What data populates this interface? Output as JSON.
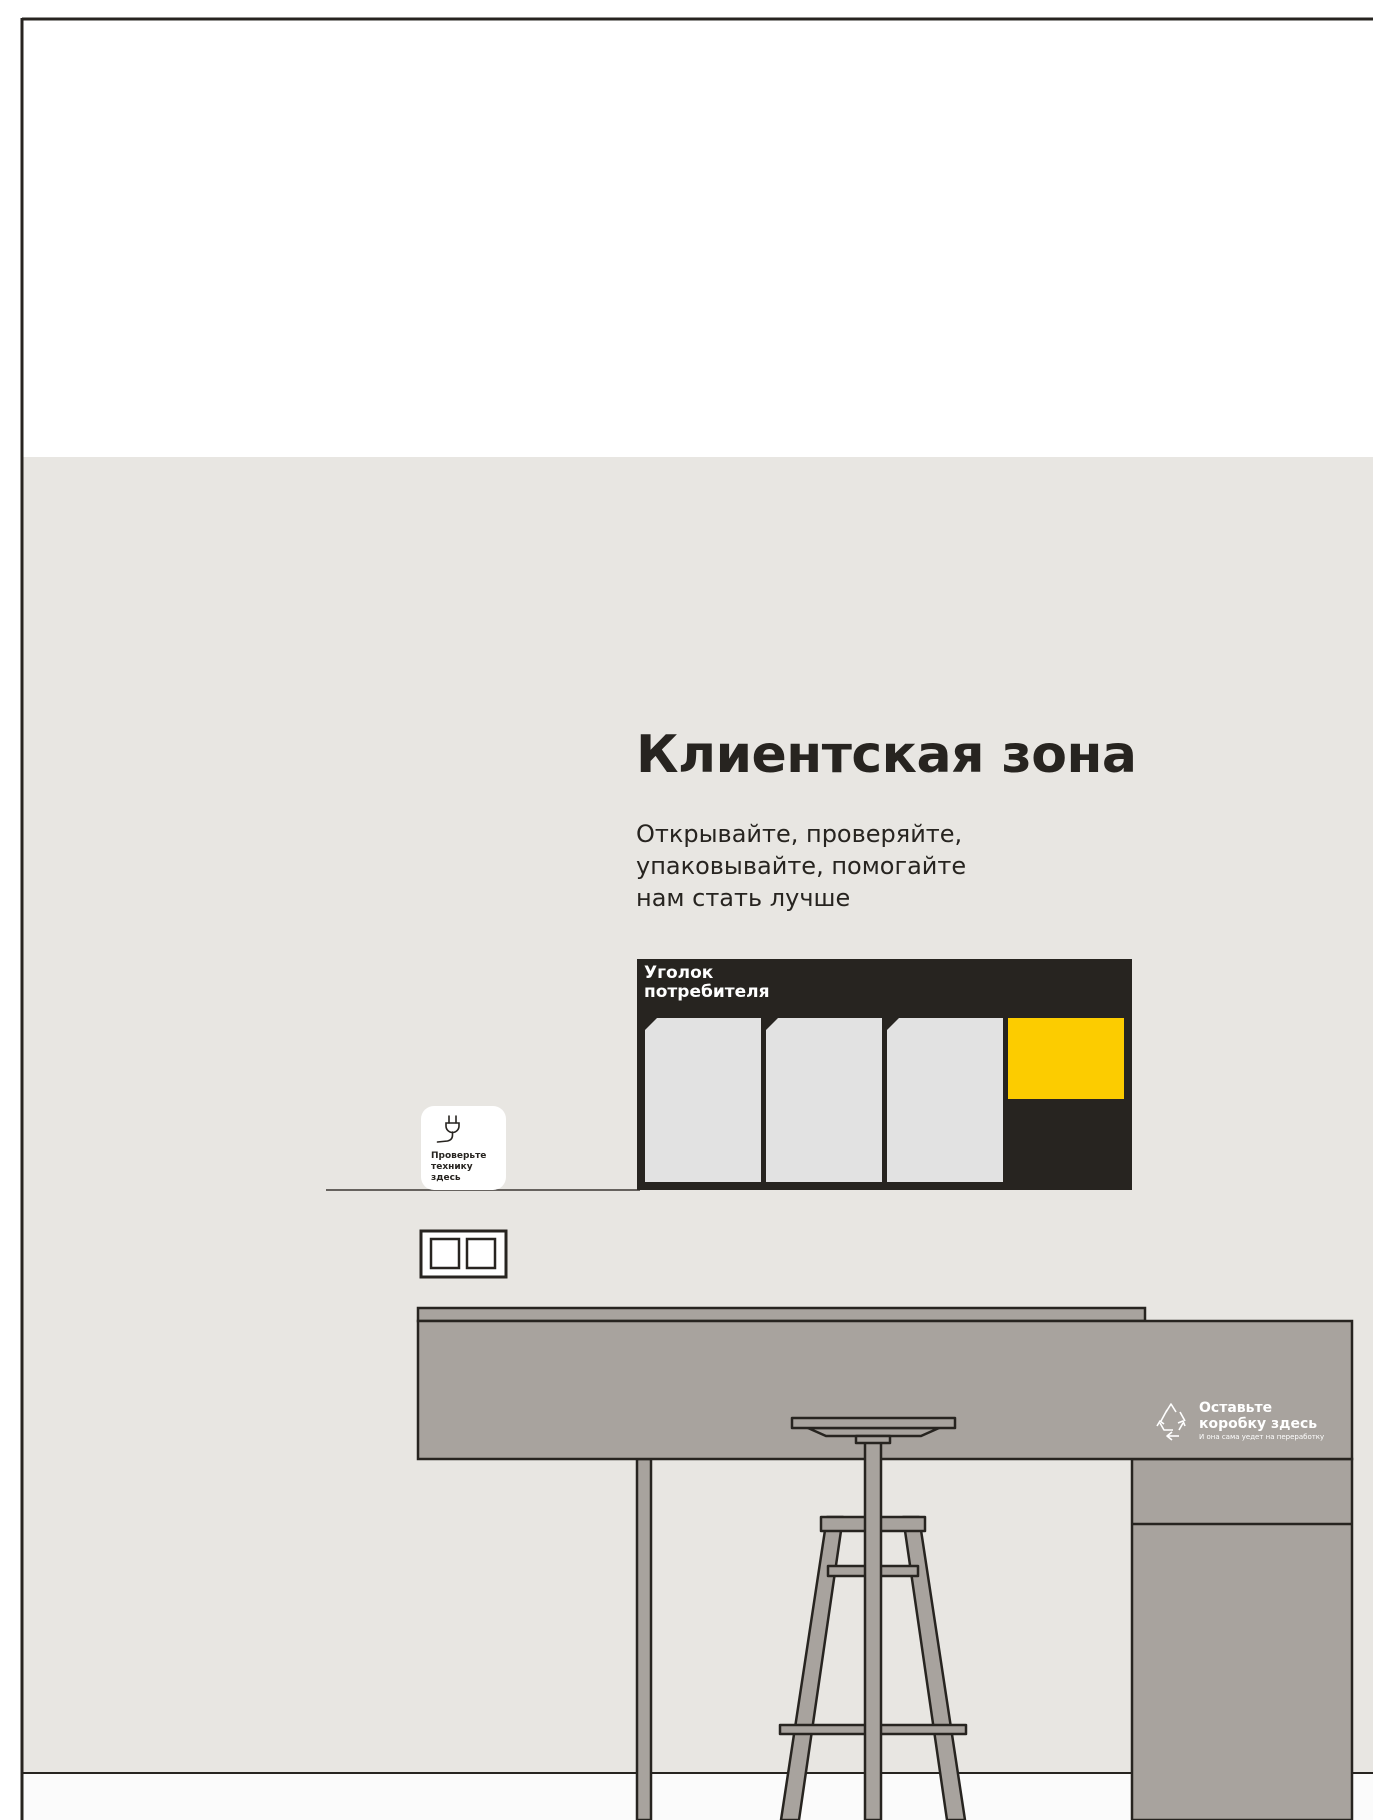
{
  "heading": {
    "title": "Клиентская зона",
    "subtitle_lines": [
      "Открывайте, проверяйте,",
      "упаковывайте, помогайте",
      "нам стать лучше"
    ]
  },
  "consumer_corner": {
    "title_lines": [
      "Уголок",
      "потребителя"
    ]
  },
  "check_sign": {
    "lines": [
      "Проверьте",
      "технику",
      "здесь"
    ],
    "icon": "plug-icon"
  },
  "box_sign": {
    "title_lines": [
      "Оставьте",
      "коробку здесь"
    ],
    "note": "И она сама уедет на переработку",
    "icon": "recycle-icon"
  },
  "colors": {
    "wall": "#e8e6e2",
    "outline": "#272420",
    "board": "#272420",
    "sheet": "#e2e2e2",
    "accent_yellow": "#fccc00",
    "furniture": "#a8a39e"
  }
}
